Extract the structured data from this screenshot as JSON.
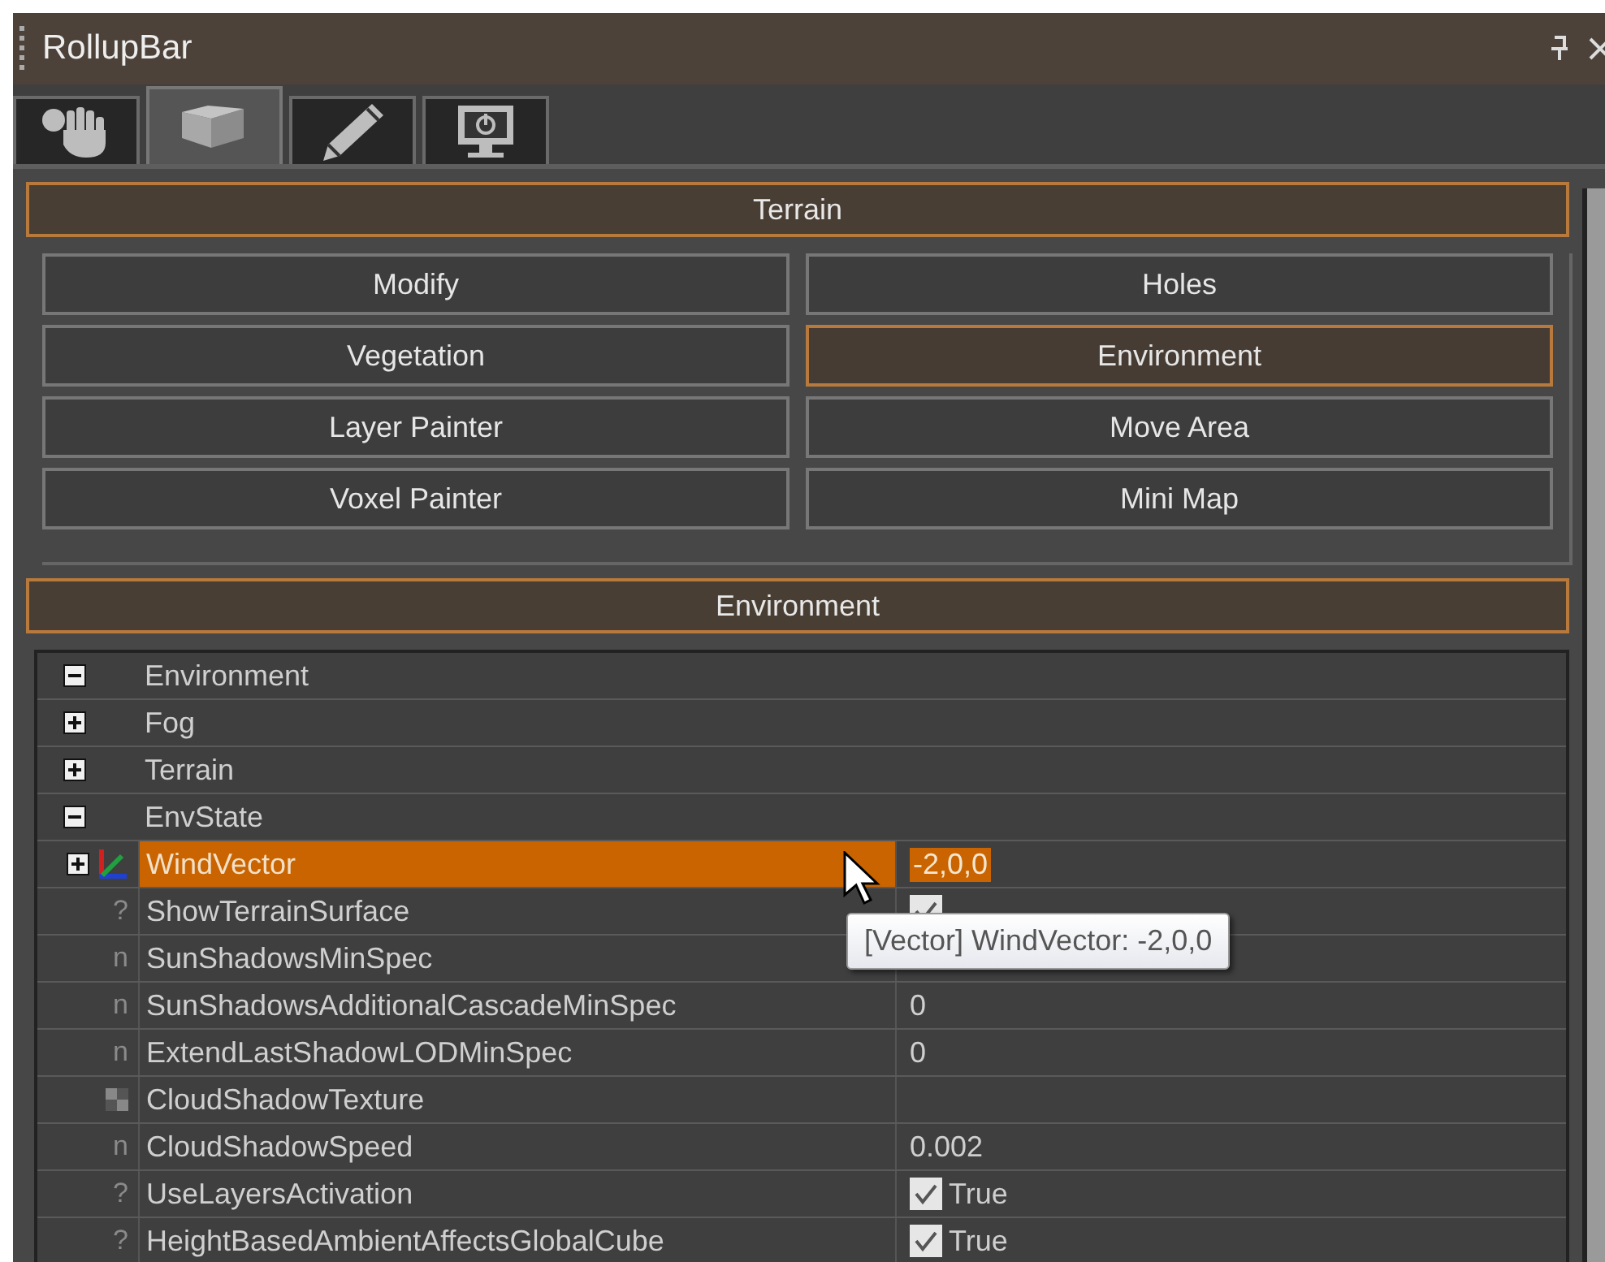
{
  "window": {
    "title": "RollupBar"
  },
  "tabs": [
    {
      "kind": "hand",
      "selected": false
    },
    {
      "kind": "cube",
      "selected": true
    },
    {
      "kind": "pencil",
      "selected": false
    },
    {
      "kind": "monitor",
      "selected": false
    }
  ],
  "terrain_panel": {
    "title": "Terrain",
    "buttons": [
      {
        "label": "Modify",
        "selected": false
      },
      {
        "label": "Holes",
        "selected": false
      },
      {
        "label": "Vegetation",
        "selected": false
      },
      {
        "label": "Environment",
        "selected": true
      },
      {
        "label": "Layer Painter",
        "selected": false
      },
      {
        "label": "Move Area",
        "selected": false
      },
      {
        "label": "Voxel Painter",
        "selected": false
      },
      {
        "label": "Mini Map",
        "selected": false
      }
    ]
  },
  "environment_panel": {
    "title": "Environment",
    "tree": [
      {
        "label": "Environment",
        "expanded": true,
        "children": [
          {
            "label": "Fog",
            "expanded": false
          },
          {
            "label": "Terrain",
            "expanded": false
          },
          {
            "label": "EnvState",
            "expanded": true,
            "properties": [
              {
                "name": "WindVector",
                "kind": "vector",
                "expanded": false,
                "selected": true,
                "value": "-2,0,0"
              },
              {
                "name": "ShowTerrainSurface",
                "kind": "bool",
                "icon": "?",
                "selected": false,
                "checked": true
              },
              {
                "name": "SunShadowsMinSpec",
                "kind": "number",
                "icon": "n",
                "selected": false
              },
              {
                "name": "SunShadowsAdditionalCascadeMinSpec",
                "kind": "number",
                "icon": "n",
                "selected": false,
                "value": "0"
              },
              {
                "name": "ExtendLastShadowLODMinSpec",
                "kind": "number",
                "icon": "n",
                "selected": false,
                "value": "0"
              },
              {
                "name": "CloudShadowTexture",
                "kind": "texture",
                "selected": false
              },
              {
                "name": "CloudShadowSpeed",
                "kind": "number",
                "icon": "n",
                "selected": false,
                "value": "0.002"
              },
              {
                "name": "UseLayersActivation",
                "kind": "bool",
                "icon": "?",
                "selected": false,
                "checked": true,
                "value": "True"
              },
              {
                "name": "HeightBasedAmbientAffectsGlobalCube",
                "kind": "bool",
                "icon": "?",
                "selected": false,
                "checked": true,
                "value": "True"
              }
            ]
          }
        ]
      }
    ],
    "tooltip": "[Vector] WindVector: -2,0,0"
  }
}
